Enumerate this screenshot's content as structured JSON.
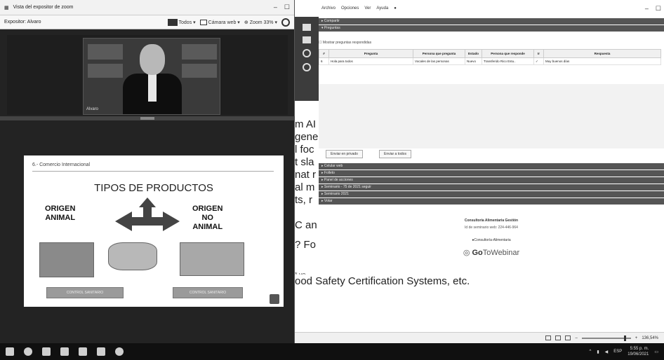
{
  "left_window": {
    "title": "Vista del expositor de zoom",
    "options_label": "Expositor: Alvaro",
    "toolbar": {
      "todos": "Todos ▾",
      "camera": "Cámara web ▾",
      "zoom": "Zoom 33% ▾"
    },
    "cam_name": "Alvaro",
    "slide": {
      "header": "6.- Comercio Internacional",
      "title": "TIPOS DE PRODUCTOS",
      "left_label_1": "ORIGEN",
      "left_label_2": "ANIMAL",
      "right_label_1": "ORIGEN",
      "right_label_2": "NO",
      "right_label_3": "ANIMAL",
      "btn_left": "CONTROL SANITARIO",
      "btn_right": "CONTROL SANITARIO"
    }
  },
  "right_window": {
    "menu": [
      "Archivo",
      "Opciones",
      "Ver",
      "Ayuda"
    ],
    "section_top_1": "▸ Compartir",
    "section_top_2": "▾ Preguntas",
    "people_header": "☐ Mostrar preguntas respondidas",
    "table": {
      "headers": [
        "#",
        "Pregunta",
        "Persona que pregunta",
        "Estado",
        "Persona que responde",
        "Ir",
        "Respuesta"
      ],
      "rows": [
        [
          "6",
          "Hola para todos",
          "Vocales de las personas",
          "Nuevo",
          "Transferido Rico Estu..",
          "✓",
          "Muy buenos días"
        ]
      ]
    },
    "buttons": {
      "show": "Enviar en privado",
      "send_all": "Enviar a todos"
    },
    "sections": [
      "▸ Celular web",
      "▸ Folleto",
      "▸ Panel de acciones",
      "▸ Seminario - 75 de 2021 seguir",
      "▸ Seminario 2021",
      "▸ Votar"
    ],
    "info": {
      "title": "Consultoría Alimentaria Gestión",
      "sub": "Id de seminario web: 224-446-964",
      "site": "●Consultoría-Alimentaria",
      "logo_prefix": "Go",
      "logo_main": "ToWebinar"
    },
    "status": {
      "zoom": "136,54%"
    }
  },
  "overlay_lines": [
    "m AI",
    "gene",
    "l foc",
    "t sla",
    "nat r",
    "al m",
    "ts, r",
    "C an",
    "? Fo"
  ],
  "bottom_text": {
    "line1": "velo          ood Safety Certification Systems, etc.",
    "line0": "* ve..."
  },
  "taskbar": {
    "time": "5:55 p. m.",
    "date": "19/06/2021",
    "lang": "ESP"
  }
}
